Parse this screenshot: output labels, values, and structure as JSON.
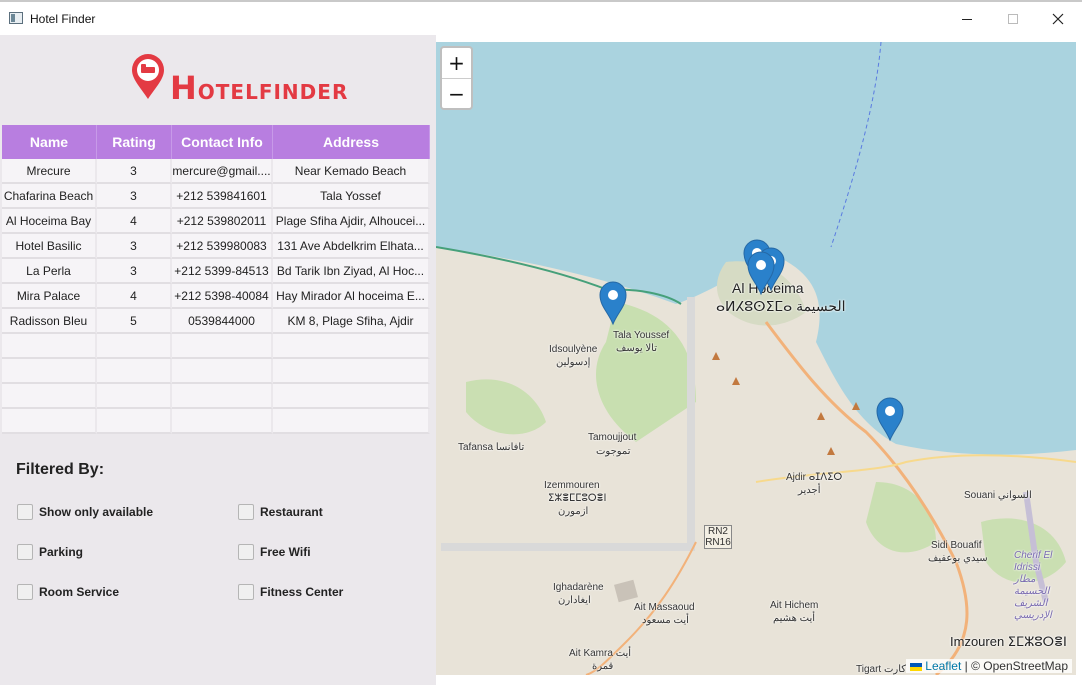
{
  "window": {
    "title": "Hotel Finder"
  },
  "logo": {
    "first": "H",
    "rest": "OTELFINDER"
  },
  "table": {
    "headers": [
      "Name",
      "Rating",
      "Contact Info",
      "Address"
    ],
    "rows": [
      [
        "Mrecure",
        "3",
        "mercure@gmail....",
        "Near Kemado Beach"
      ],
      [
        "Chafarina Beach",
        "3",
        "+212 539841601",
        "Tala Yossef"
      ],
      [
        "Al Hoceima Bay",
        "4",
        "+212 539802011",
        "Plage Sfiha Ajdir, Alhoucei..."
      ],
      [
        "Hotel Basilic",
        "3",
        "+212 539980083",
        "131 Ave Abdelkrim Elhata..."
      ],
      [
        "La Perla",
        "3",
        "+212 5399-84513",
        "Bd Tarik Ibn Ziyad, Al Hoc..."
      ],
      [
        "Mira Palace",
        "4",
        "+212 5398-40084",
        "Hay Mirador Al hoceima E..."
      ],
      [
        "Radisson Bleu",
        "5",
        "0539844000",
        "KM 8, Plage Sfiha, Ajdir"
      ]
    ]
  },
  "filters": {
    "title": "Filtered By:",
    "show_only_available": "Show only available",
    "restaurant": "Restaurant",
    "parking": "Parking",
    "free_wifi": "Free Wifi",
    "room_service": "Room Service",
    "fitness_center": "Fitness Center"
  },
  "map": {
    "zoom_in": "+",
    "zoom_out": "−",
    "attribution_link": "Leaflet",
    "attribution_rest": "| © OpenStreetMap",
    "labels": {
      "al_hoceima": "Al Hoceima",
      "al_hoceima_local": "ⴰⵍⵃⵓⵙⵉⵎⴰ الحسيمة",
      "tala_youssef": "Tala Youssef",
      "tala_youssef_ar": "تالا يوسف",
      "idsoulyene": "Idsoulyène",
      "idsoulyene_ar": "إدسولين",
      "tafansa": "Tafansa تافانسا",
      "tamoujjout": "Tamoujjout",
      "tamoujjout_ar": "تموجوت",
      "izemmouren": "Izemmouren",
      "izemmouren_tz": "ⵉⵣⴻⵎⵎⵓⵔⴻⵏ",
      "izemmouren_ar": "ازمورن",
      "ajdir": "Ajdir ⴰⵊⴷⵉⵔ",
      "ajdir_ar": "أجدير",
      "souani": "Souani السواني",
      "sidi_bouafif": "Sidi Bouafif",
      "sidi_bouafif_ar": "سيدي بوعفيف",
      "airport": "Cherif El Idrissi مطار الحسيمة الشريف الإدريسي",
      "ighadarene": "Ighadarène",
      "ighadarene_ar": "ايغادارن",
      "ait_massaoud": "Ait Massaoud",
      "ait_massaoud_ar": "أيت مسعود",
      "ait_hichem": "Ait Hichem",
      "ait_hichem_ar": "أيت هشيم",
      "ait_kamra": "Ait Kamra أيت",
      "ait_kamra_ar": "قمرة",
      "imzouren": "Imzouren ⵉⵎⵣⵓⵔⴻⵏ",
      "tigart": "Tigart كارت",
      "road": "RN2 RN16"
    }
  }
}
